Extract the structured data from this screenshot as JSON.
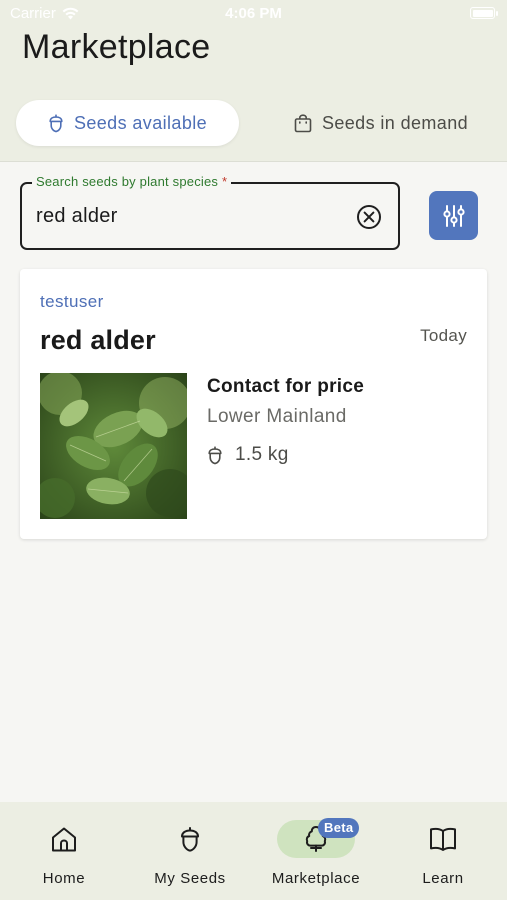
{
  "status_bar": {
    "carrier": "Carrier",
    "time": "4:06 PM"
  },
  "header": {
    "title": "Marketplace"
  },
  "tabs": [
    {
      "label": "Seeds available",
      "icon": "acorn-icon",
      "selected": true
    },
    {
      "label": "Seeds in demand",
      "icon": "shopping-bag-icon",
      "selected": false
    }
  ],
  "search": {
    "label": "Search seeds by plant species",
    "required_mark": "*",
    "value": "red alder"
  },
  "listing": {
    "user": "testuser",
    "title": "red alder",
    "date": "Today",
    "price": "Contact for price",
    "location": "Lower Mainland",
    "quantity": "1.5 kg"
  },
  "nav": {
    "items": [
      {
        "label": "Home",
        "icon": "home-icon"
      },
      {
        "label": "My Seeds",
        "icon": "acorn-icon"
      },
      {
        "label": "Marketplace",
        "icon": "tree-icon",
        "badge": "Beta",
        "active": true
      },
      {
        "label": "Learn",
        "icon": "book-icon"
      }
    ]
  },
  "colors": {
    "accent": "#5276bd",
    "header_bg": "#eceee3",
    "active_nav_bg": "#cfe3bf",
    "label_green": "#2f7a2f"
  }
}
